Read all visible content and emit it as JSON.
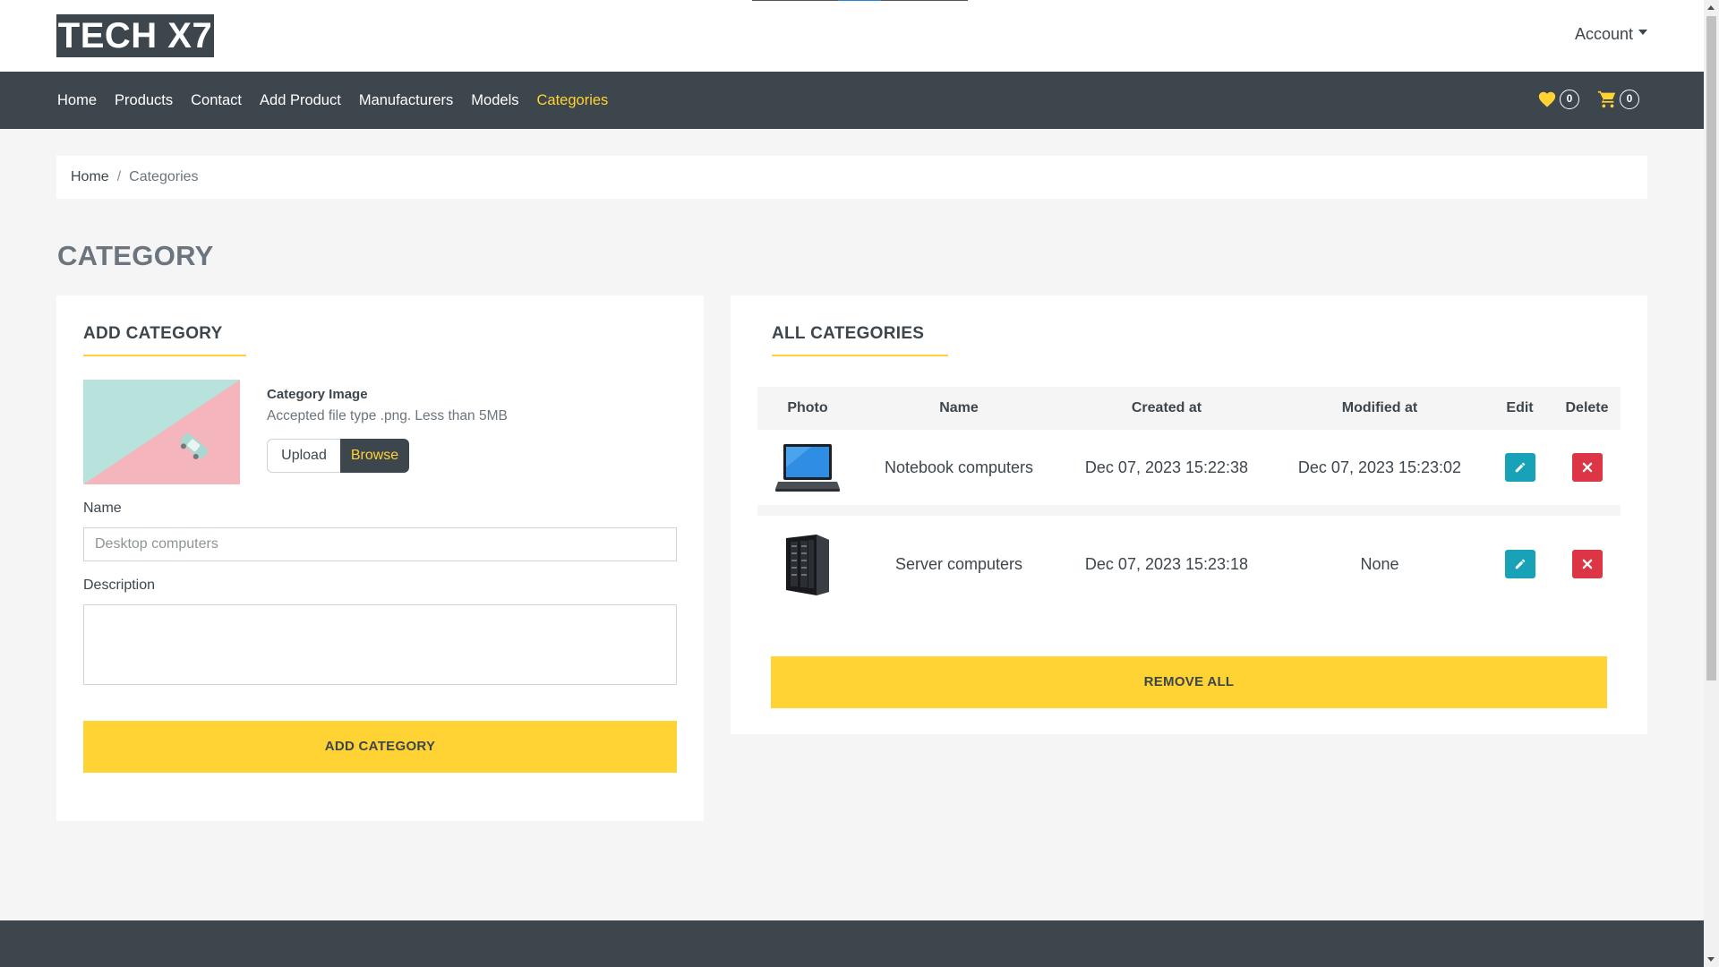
{
  "header": {
    "logo": "TECH X7",
    "account_label": "Account"
  },
  "nav": {
    "links": [
      "Home",
      "Products",
      "Contact",
      "Add Product",
      "Manufacturers",
      "Models",
      "Categories"
    ],
    "active": "Categories",
    "wishlist_count": "0",
    "cart_count": "0"
  },
  "breadcrumb": {
    "home": "Home",
    "separator": "/",
    "current": "Categories"
  },
  "page": {
    "title": "CATEGORY"
  },
  "add_category": {
    "section_title": "ADD CATEGORY",
    "image_label": "Category Image",
    "image_help": "Accepted file type .png. Less than 5MB",
    "upload_label": "Upload",
    "browse_label": "Browse",
    "name_label": "Name",
    "name_placeholder": "Desktop computers",
    "description_label": "Description",
    "description_value": "",
    "submit_label": "ADD CATEGORY"
  },
  "all_categories": {
    "section_title": "ALL CATEGORIES",
    "columns": [
      "Photo",
      "Name",
      "Created at",
      "Modified at",
      "Edit",
      "Delete"
    ],
    "rows": [
      {
        "photo": "laptop-image",
        "name": "Notebook computers",
        "created_at": "Dec 07, 2023 15:22:38",
        "modified_at": "Dec 07, 2023 15:23:02"
      },
      {
        "photo": "server-image",
        "name": "Server computers",
        "created_at": "Dec 07, 2023 15:23:18",
        "modified_at": "None"
      }
    ],
    "remove_all_label": "REMOVE ALL"
  },
  "colors": {
    "primary_dark": "#3d464d",
    "accent_yellow": "#ffd333",
    "edit_teal": "#17a2b8",
    "delete_red": "#dc3545",
    "background": "#f5f5f5"
  },
  "icons": {
    "wishlist": "heart-icon",
    "cart": "shopping-cart-icon",
    "edit": "pencil-icon",
    "delete": "close-icon",
    "account": "caret-down-icon"
  }
}
